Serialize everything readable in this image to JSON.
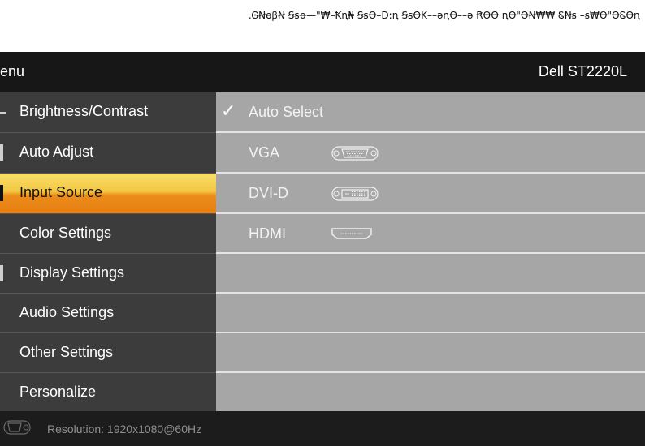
{
  "caption": ".ᎶꞤɵꞵꞤ Ꞩꞩꝋ—\"₩–Ꝁꞑ₦ ꞨꞩꝊ–Ð꞉ꞑ ꞨꞩꝊK––əꞑꝊ––ə ꞦꝊꝊ ꞑꝊ\"ꝊꞤ₩₩ ᏋꞤꞩ –ꞩ₩Ꝋ\"ꝊᏋꝊꞑ",
  "osd": {
    "title": "enu",
    "model": "Dell ST2220L",
    "colors": {
      "active_top": "#f8e06c",
      "active_bottom": "#e57e12",
      "panel": "#a6a6a6",
      "menu": "#3c3c3c"
    }
  },
  "menu": {
    "items": [
      {
        "label": "Brightness/Contrast",
        "icon": "dash-icon"
      },
      {
        "label": "Auto Adjust",
        "icon": "marker-icon"
      },
      {
        "label": "Input Source",
        "icon": "marker-icon",
        "active": true
      },
      {
        "label": "Color Settings",
        "icon": ""
      },
      {
        "label": "Display Settings",
        "icon": "marker-icon"
      },
      {
        "label": "Audio Settings",
        "icon": ""
      },
      {
        "label": "Other Settings",
        "icon": ""
      },
      {
        "label": "Personalize",
        "icon": ""
      }
    ]
  },
  "input_options": [
    {
      "label": "Auto Select",
      "checked": true,
      "icon": "checkmark-icon"
    },
    {
      "label": "VGA",
      "icon": "vga-port-icon"
    },
    {
      "label": "DVI-D",
      "icon": "dvi-port-icon"
    },
    {
      "label": "HDMI",
      "icon": "hdmi-port-icon"
    }
  ],
  "footer": {
    "icon": "vga-port-icon",
    "resolution": "Resolution:  1920x1080@60Hz"
  }
}
